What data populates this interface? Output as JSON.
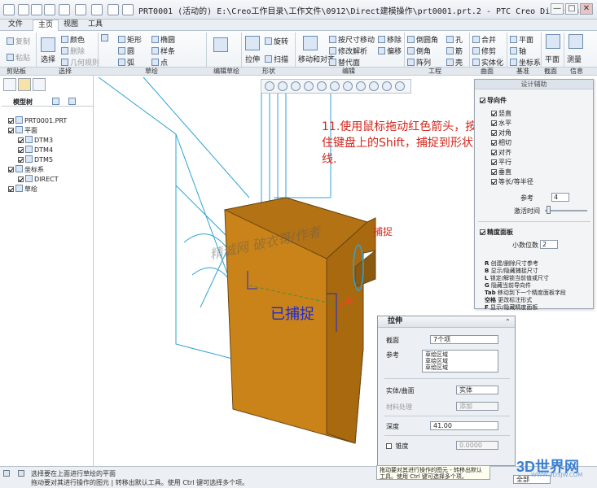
{
  "window": {
    "title": "PRT0001 (活动的) E:\\Creo工作目录\\工作文件\\0912\\Direct建模操作\\prt0001.prt.2 - PTC Creo Direct 3.0",
    "minimize": "—",
    "maximize": "□",
    "close": "✕"
  },
  "tabs": [
    "文件",
    "主页",
    "视图",
    "工具"
  ],
  "ribbon": {
    "clipboard": {
      "copy": "复制",
      "paste": "粘贴",
      "label": "剪贴板"
    },
    "select": {
      "select": "选择",
      "color": "颜色",
      "delete": "删除",
      "geometry_rule": "几何规则",
      "label": "选择"
    },
    "sketch": {
      "rectangle": "矩形",
      "ellipse": "椭圆",
      "circle": "圆",
      "spline": "样条",
      "arc": "弧",
      "point": "点",
      "label": "草绘"
    },
    "edit_sketch": {
      "label": "编辑草绘"
    },
    "shape": {
      "extrude": "拉伸",
      "revolve": "旋转",
      "sweep": "扫描",
      "label": "形状"
    },
    "edit": {
      "move_align": "移动和对齐",
      "size_move": "按尺寸移动",
      "modify_analysis": "修改解析",
      "replace": "替代面",
      "move": "移除",
      "offset": "偏移",
      "label": "编辑"
    },
    "engineering": {
      "round": "倒圆角",
      "chamfer": "倒角",
      "pattern": "阵列",
      "hole": "孔",
      "rib": "筋",
      "shell": "壳",
      "label": "工程"
    },
    "surface": {
      "merge": "合并",
      "trim": "修剪",
      "solidify": "实体化",
      "label": "曲面"
    },
    "datum": {
      "plane": "平面",
      "axis": "轴",
      "csys": "坐标系",
      "label": "基准"
    },
    "section": {
      "plane": "平面",
      "label": "截面"
    },
    "info": {
      "measure": "测量",
      "label": "信息"
    }
  },
  "model_tree": {
    "tab_label": "模型树",
    "items": [
      {
        "label": "PRT0001.PRT",
        "checked": true
      },
      {
        "label": "平面",
        "checked": true
      },
      {
        "label": "DTM3",
        "checked": true
      },
      {
        "label": "DTM4",
        "checked": true
      },
      {
        "label": "DTM5",
        "checked": true
      },
      {
        "label": "坐标系",
        "checked": true
      },
      {
        "label": "DIRECT",
        "checked": true
      },
      {
        "label": "草绘",
        "checked": true
      }
    ]
  },
  "canvas": {
    "instruction": "11.使用鼠标拖动红色箭头，按住键盘上的Shift，捕捉到形状曲线.",
    "snap_label": "捕捉",
    "captured_label": "已捕捉",
    "watermark": "精诚网 破衣哥/作者"
  },
  "design_aid": {
    "title": "设计辅助",
    "guides_label": "导向件",
    "guides": [
      {
        "label": "竖直",
        "checked": true
      },
      {
        "label": "水平",
        "checked": true
      },
      {
        "label": "对角",
        "checked": true
      },
      {
        "label": "相切",
        "checked": true
      },
      {
        "label": "对齐",
        "checked": true
      },
      {
        "label": "平行",
        "checked": true
      },
      {
        "label": "垂直",
        "checked": true
      },
      {
        "label": "等长/等半径",
        "checked": true
      }
    ],
    "reference_label": "参考",
    "reference_value": "4",
    "delay_label": "激活时间",
    "precision_label": "精度面板",
    "decimals_label": "小数位数",
    "decimals_value": "2",
    "shortcuts": [
      {
        "key": "R",
        "text": "创建/删除尺寸参考"
      },
      {
        "key": "B",
        "text": "显示/隐藏捕捉尺寸"
      },
      {
        "key": "L",
        "text": "锁定/解锁当前值或尺寸"
      },
      {
        "key": "G",
        "text": "隐藏当前导向件"
      },
      {
        "key": "Tab",
        "text": "移动到下一个精度面板字段"
      },
      {
        "key": "空格",
        "text": "更改标注形式"
      },
      {
        "key": "F",
        "text": "显示/隐藏精度面板"
      }
    ]
  },
  "extrude": {
    "title": "拉伸",
    "section_label": "截面",
    "section_value": "7个项",
    "refs_label": "参考",
    "refs": [
      "草绘区域",
      "草绘区域",
      "草绘区域"
    ],
    "solid_label": "实体/曲面",
    "solid_value": "实体",
    "material_label": "材料处理",
    "material_value": "添加",
    "depth_label": "深度",
    "depth_value": "41.00",
    "taper_label": "锥度",
    "taper_value": "0.0000"
  },
  "status": {
    "line1": "选择要在上面进行草绘的平面",
    "line2": "拖动要对其进行操作的图元 | 转移出默认工具。使用 Ctrl 键可选择多个项。",
    "tooltip": "拖动要对其进行操作的图元 - 转移出默认工具。使用 Ctrl 键可选择多个项。",
    "filter": "全部"
  },
  "logo": {
    "text": "3D世界网",
    "sub": "WWW.3DSJW.COM"
  },
  "colors": {
    "part": "#c98319",
    "part_dark": "#8a5a10",
    "curve": "#2fa3d6",
    "annot": "#d4251c",
    "captured": "#1a2bd8"
  }
}
